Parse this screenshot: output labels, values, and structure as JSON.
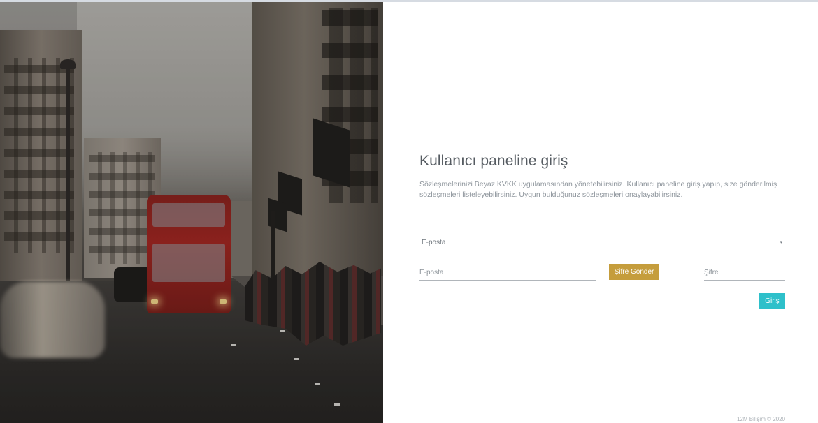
{
  "login": {
    "title": "Kullanıcı paneline giriş",
    "description": "Sözleşmelerinizi Beyaz KVKK uygulamasından yönetebilirsiniz. Kullanıcı paneline giriş yapıp, size gönderilmiş sözleşmeleri listeleyebilirsiniz. Uygun bulduğunuz sözleşmeleri onaylayabilirsiniz.",
    "select": {
      "selected_value": "E-posta",
      "arrow": "▾"
    },
    "email_field": {
      "placeholder": "E-posta",
      "value": ""
    },
    "send_password_button": "Şifre Gönder",
    "password_field": {
      "placeholder": "Şifre",
      "value": ""
    },
    "login_button": "Giriş"
  },
  "footer": {
    "copyright": "12M Bilişim © 2020"
  },
  "colors": {
    "accent_gold": "#c59d3c",
    "accent_teal": "#2ec0ca",
    "title_text": "#555b61",
    "muted_text": "#8e959c"
  },
  "photo": {
    "subject": "city-street-photo"
  }
}
